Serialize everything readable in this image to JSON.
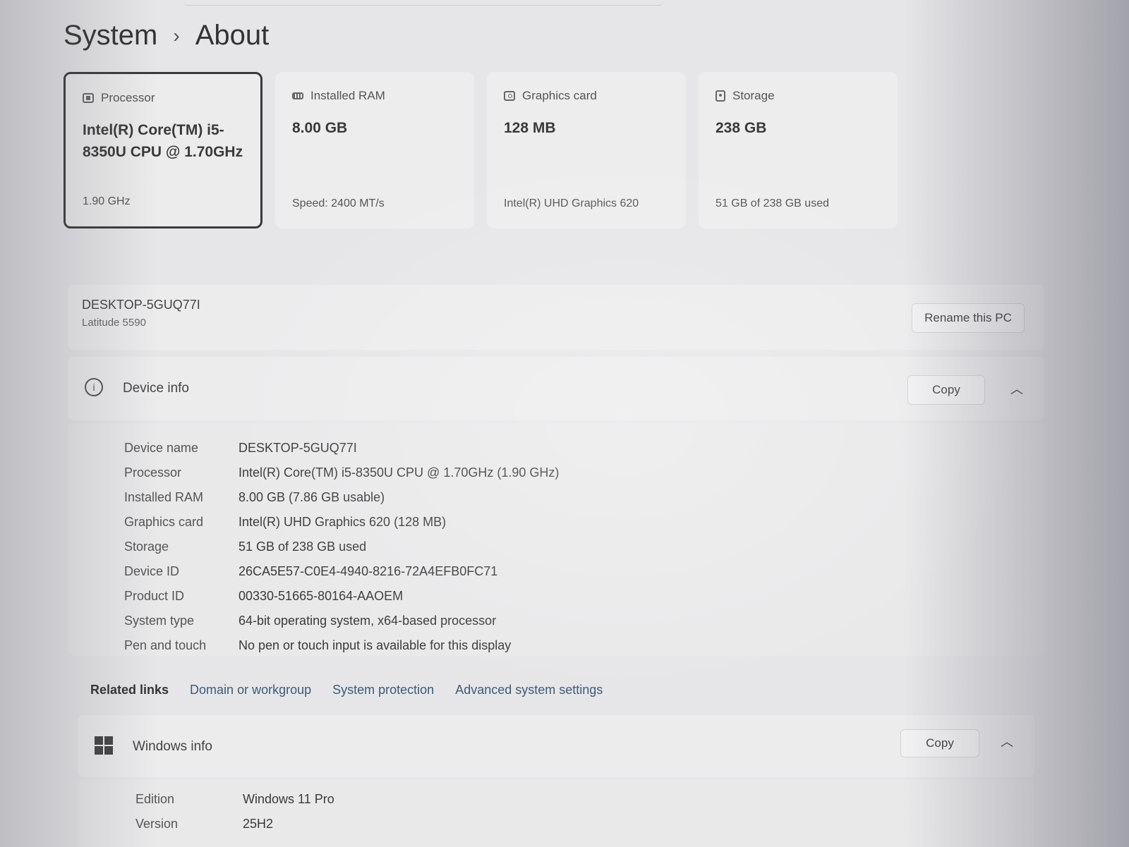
{
  "breadcrumb": {
    "parent": "System",
    "separator": "›",
    "current": "About"
  },
  "cards": [
    {
      "label": "Processor",
      "value": "Intel(R) Core(TM) i5-8350U CPU @ 1.70GHz",
      "sub": "1.90 GHz",
      "icon": "processor-icon"
    },
    {
      "label": "Installed RAM",
      "value": "8.00 GB",
      "sub": "Speed: 2400 MT/s",
      "icon": "ram-icon"
    },
    {
      "label": "Graphics card",
      "value": "128 MB",
      "sub": "Intel(R) UHD Graphics 620",
      "icon": "graphics-card-icon"
    },
    {
      "label": "Storage",
      "value": "238 GB",
      "sub": "51 GB of 238 GB used",
      "icon": "storage-icon"
    }
  ],
  "pc": {
    "name": "DESKTOP-5GUQ77I",
    "model": "Latitude 5590",
    "rename_label": "Rename this PC"
  },
  "device_info": {
    "title": "Device info",
    "copy_label": "Copy",
    "rows": [
      {
        "key": "Device name",
        "value": "DESKTOP-5GUQ77I"
      },
      {
        "key": "Processor",
        "value": "Intel(R) Core(TM) i5-8350U CPU @ 1.70GHz (1.90 GHz)"
      },
      {
        "key": "Installed RAM",
        "value": "8.00 GB (7.86 GB usable)"
      },
      {
        "key": "Graphics card",
        "value": "Intel(R) UHD Graphics 620 (128 MB)"
      },
      {
        "key": "Storage",
        "value": "51 GB of 238 GB used"
      },
      {
        "key": "Device ID",
        "value": "26CA5E57-C0E4-4940-8216-72A4EFB0FC71"
      },
      {
        "key": "Product ID",
        "value": "00330-51665-80164-AAOEM"
      },
      {
        "key": "System type",
        "value": "64-bit operating system, x64-based processor"
      },
      {
        "key": "Pen and touch",
        "value": "No pen or touch input is available for this display"
      }
    ]
  },
  "related_links": {
    "label": "Related links",
    "links": [
      "Domain or workgroup",
      "System protection",
      "Advanced system settings"
    ]
  },
  "windows_info": {
    "title": "Windows info",
    "copy_label": "Copy",
    "rows": [
      {
        "key": "Edition",
        "value": "Windows 11 Pro"
      },
      {
        "key": "Version",
        "value": "25H2"
      }
    ]
  }
}
